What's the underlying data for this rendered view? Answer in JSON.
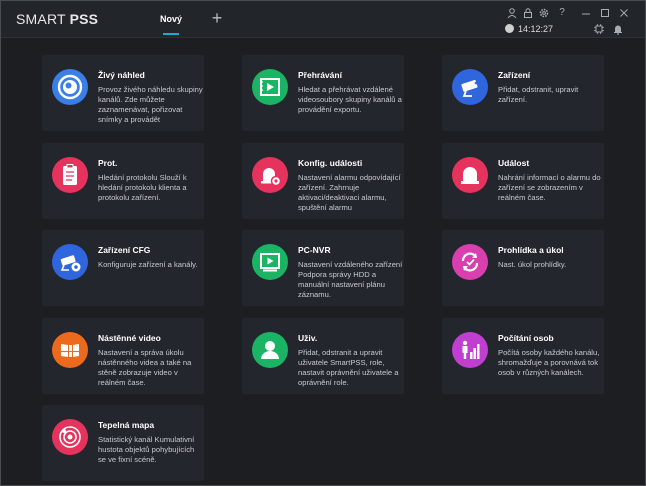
{
  "app": {
    "brand_light": "SMART ",
    "brand_bold": "PSS"
  },
  "tabs": [
    {
      "label": "Nový"
    }
  ],
  "status": {
    "time": "14:12:27"
  },
  "tiles": [
    {
      "title": "Živý náhled",
      "desc": "Provoz živého náhledu skupiny kanálů. Zde můžete zaznamenávat, pořizovat snímky a provádět",
      "color": "#3a7ee8",
      "icon": "live-view-icon"
    },
    {
      "title": "Přehrávání",
      "desc": "Hledat a přehrávat vzdálené videosoubory skupiny kanálů a provádění exportu.",
      "color": "#1bb364",
      "icon": "playback-icon"
    },
    {
      "title": "Zařízení",
      "desc": "Přidat, odstranit, upravit zařízení.",
      "color": "#2f65dd",
      "icon": "device-camera-icon"
    },
    {
      "title": "Prot.",
      "desc": "Hledání protokolu Slouží k hledání protokolu klienta a protokolu zařízení.",
      "color": "#e6335e",
      "icon": "clipboard-log-icon"
    },
    {
      "title": "Konfig. události",
      "desc": "Nastavení alarmu odpovídající zařízení. Zahrnuje aktivaci/deaktivaci alarmu, spuštění alarmu",
      "color": "#e6335e",
      "icon": "event-config-icon"
    },
    {
      "title": "Událost",
      "desc": "Nahrání informací o alarmu do zařízení se zobrazením v reálném čase.",
      "color": "#e6335e",
      "icon": "alarm-icon"
    },
    {
      "title": "Zařízení CFG",
      "desc": "Konfiguruje zařízení a kanály.",
      "color": "#2f65dd",
      "icon": "device-config-icon"
    },
    {
      "title": "PC-NVR",
      "desc": "Nastavení vzdáleného zařízení Podpora správy HDD a manuální nastavení plánu záznamu.",
      "color": "#1bb364",
      "icon": "pc-nvr-icon"
    },
    {
      "title": "Prohlídka a úkol",
      "desc": "Nast. úkol prohlídky.",
      "color": "#d93fae",
      "icon": "tour-task-icon"
    },
    {
      "title": "Nástěnné video",
      "desc": "Nastavení a správa úkolu nástěnného videa a také na stěně zobrazuje video v reálném čase.",
      "color": "#ec6a1d",
      "icon": "video-wall-icon"
    },
    {
      "title": "Uživ.",
      "desc": "Přidat, odstranit a upravit uživatele SmartPSS, role, nastavit oprávnění uživatele a oprávnění role.",
      "color": "#1bb364",
      "icon": "user-icon"
    },
    {
      "title": "Počítání osob",
      "desc": "Počítá osoby každého kanálu, shromažďuje a porovnává tok osob v různých kanálech.",
      "color": "#c03fd0",
      "icon": "people-counting-icon"
    },
    {
      "title": "Tepelná mapa",
      "desc": "Statistický kanál Kumulativní hustota objektů pohybujících se ve fixní scéně.",
      "color": "#e6335e",
      "icon": "heat-map-icon"
    }
  ]
}
